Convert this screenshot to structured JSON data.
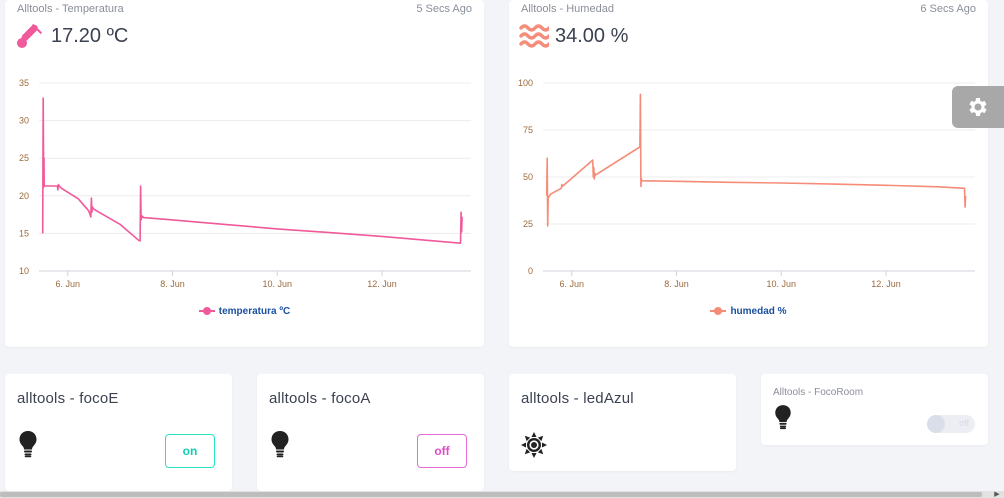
{
  "temperature_card": {
    "title": "Alltools - Temperatura",
    "time": "5 Secs Ago",
    "value": "17.20 ºC",
    "icon": "thermometer-icon",
    "color": "#f05a9b"
  },
  "humidity_card": {
    "title": "Alltools - Humedad",
    "time": "6 Secs Ago",
    "value": "34.00 %",
    "icon": "waves-icon",
    "color": "#f58c78"
  },
  "devices": {
    "focoE": {
      "title": "alltools - focoE",
      "button": "on",
      "icon": "lightbulb-icon"
    },
    "focoA": {
      "title": "alltools - focoA",
      "button": "off",
      "icon": "lightbulb-icon"
    },
    "ledAzul": {
      "title": "alltools - ledAzul",
      "icon": "sun-icon"
    },
    "focoRoom": {
      "title": "Alltools - FocoRoom",
      "switch_label": "off",
      "icon": "lightbulb-icon"
    }
  },
  "settings": {
    "icon": "gear-icon"
  },
  "chart_data": [
    {
      "type": "line",
      "title": "",
      "xlabel": "",
      "ylabel": "",
      "x_tick_labels": [
        "6. Jun",
        "8. Jun",
        "10. Jun",
        "12. Jun"
      ],
      "x_ticks": [
        6,
        8,
        10,
        12
      ],
      "y_ticks": [
        10,
        15,
        20,
        25,
        30,
        35
      ],
      "xlim": [
        5.45,
        13.7
      ],
      "ylim": [
        10,
        35
      ],
      "series": [
        {
          "name": "temperatura ºC",
          "color": "#f05a9b",
          "x": [
            5.52,
            5.53,
            5.54,
            5.545,
            5.55,
            5.56,
            5.8,
            5.81,
            5.82,
            5.85,
            5.88,
            6.2,
            6.4,
            6.44,
            6.45,
            6.46,
            6.47,
            6.5,
            7.0,
            7.35,
            7.38,
            7.39,
            7.4,
            7.42,
            7.45,
            8.0,
            9.0,
            10.0,
            11.0,
            12.0,
            13.0,
            13.5,
            13.51,
            13.52,
            13.53
          ],
          "y": [
            15,
            33,
            21.2,
            25,
            21.3,
            21.3,
            21.3,
            20.8,
            21.5,
            21.2,
            21,
            19.6,
            18,
            17.2,
            19.7,
            17.8,
            18.5,
            18.2,
            16.2,
            14.1,
            14,
            21.3,
            16.8,
            17.3,
            17.1,
            16.8,
            16.2,
            15.6,
            15.1,
            14.6,
            14,
            13.7,
            17.8,
            15.2,
            17.2
          ]
        }
      ]
    },
    {
      "type": "line",
      "title": "",
      "xlabel": "",
      "ylabel": "",
      "x_tick_labels": [
        "6. Jun",
        "8. Jun",
        "10. Jun",
        "12. Jun"
      ],
      "x_ticks": [
        6,
        8,
        10,
        12
      ],
      "y_ticks": [
        0,
        25,
        50,
        75,
        100
      ],
      "xlim": [
        5.45,
        13.7
      ],
      "ylim": [
        0,
        100
      ],
      "series": [
        {
          "name": "humedad %",
          "color": "#f58c78",
          "x": [
            5.52,
            5.53,
            5.54,
            5.55,
            5.6,
            5.8,
            5.81,
            5.82,
            6.4,
            6.41,
            6.42,
            6.43,
            6.44,
            6.45,
            7.3,
            7.31,
            7.32,
            7.33,
            7.34,
            7.35,
            8.0,
            9.0,
            10.0,
            11.0,
            12.0,
            13.0,
            13.5,
            13.51,
            13.52
          ],
          "y": [
            40,
            60,
            24,
            39,
            41,
            44,
            46,
            45,
            59,
            50,
            55,
            49,
            52,
            51,
            66,
            94,
            45,
            49,
            48,
            48,
            47.7,
            47.2,
            46.8,
            46.2,
            45.6,
            44.8,
            44,
            34,
            40
          ]
        }
      ]
    }
  ]
}
